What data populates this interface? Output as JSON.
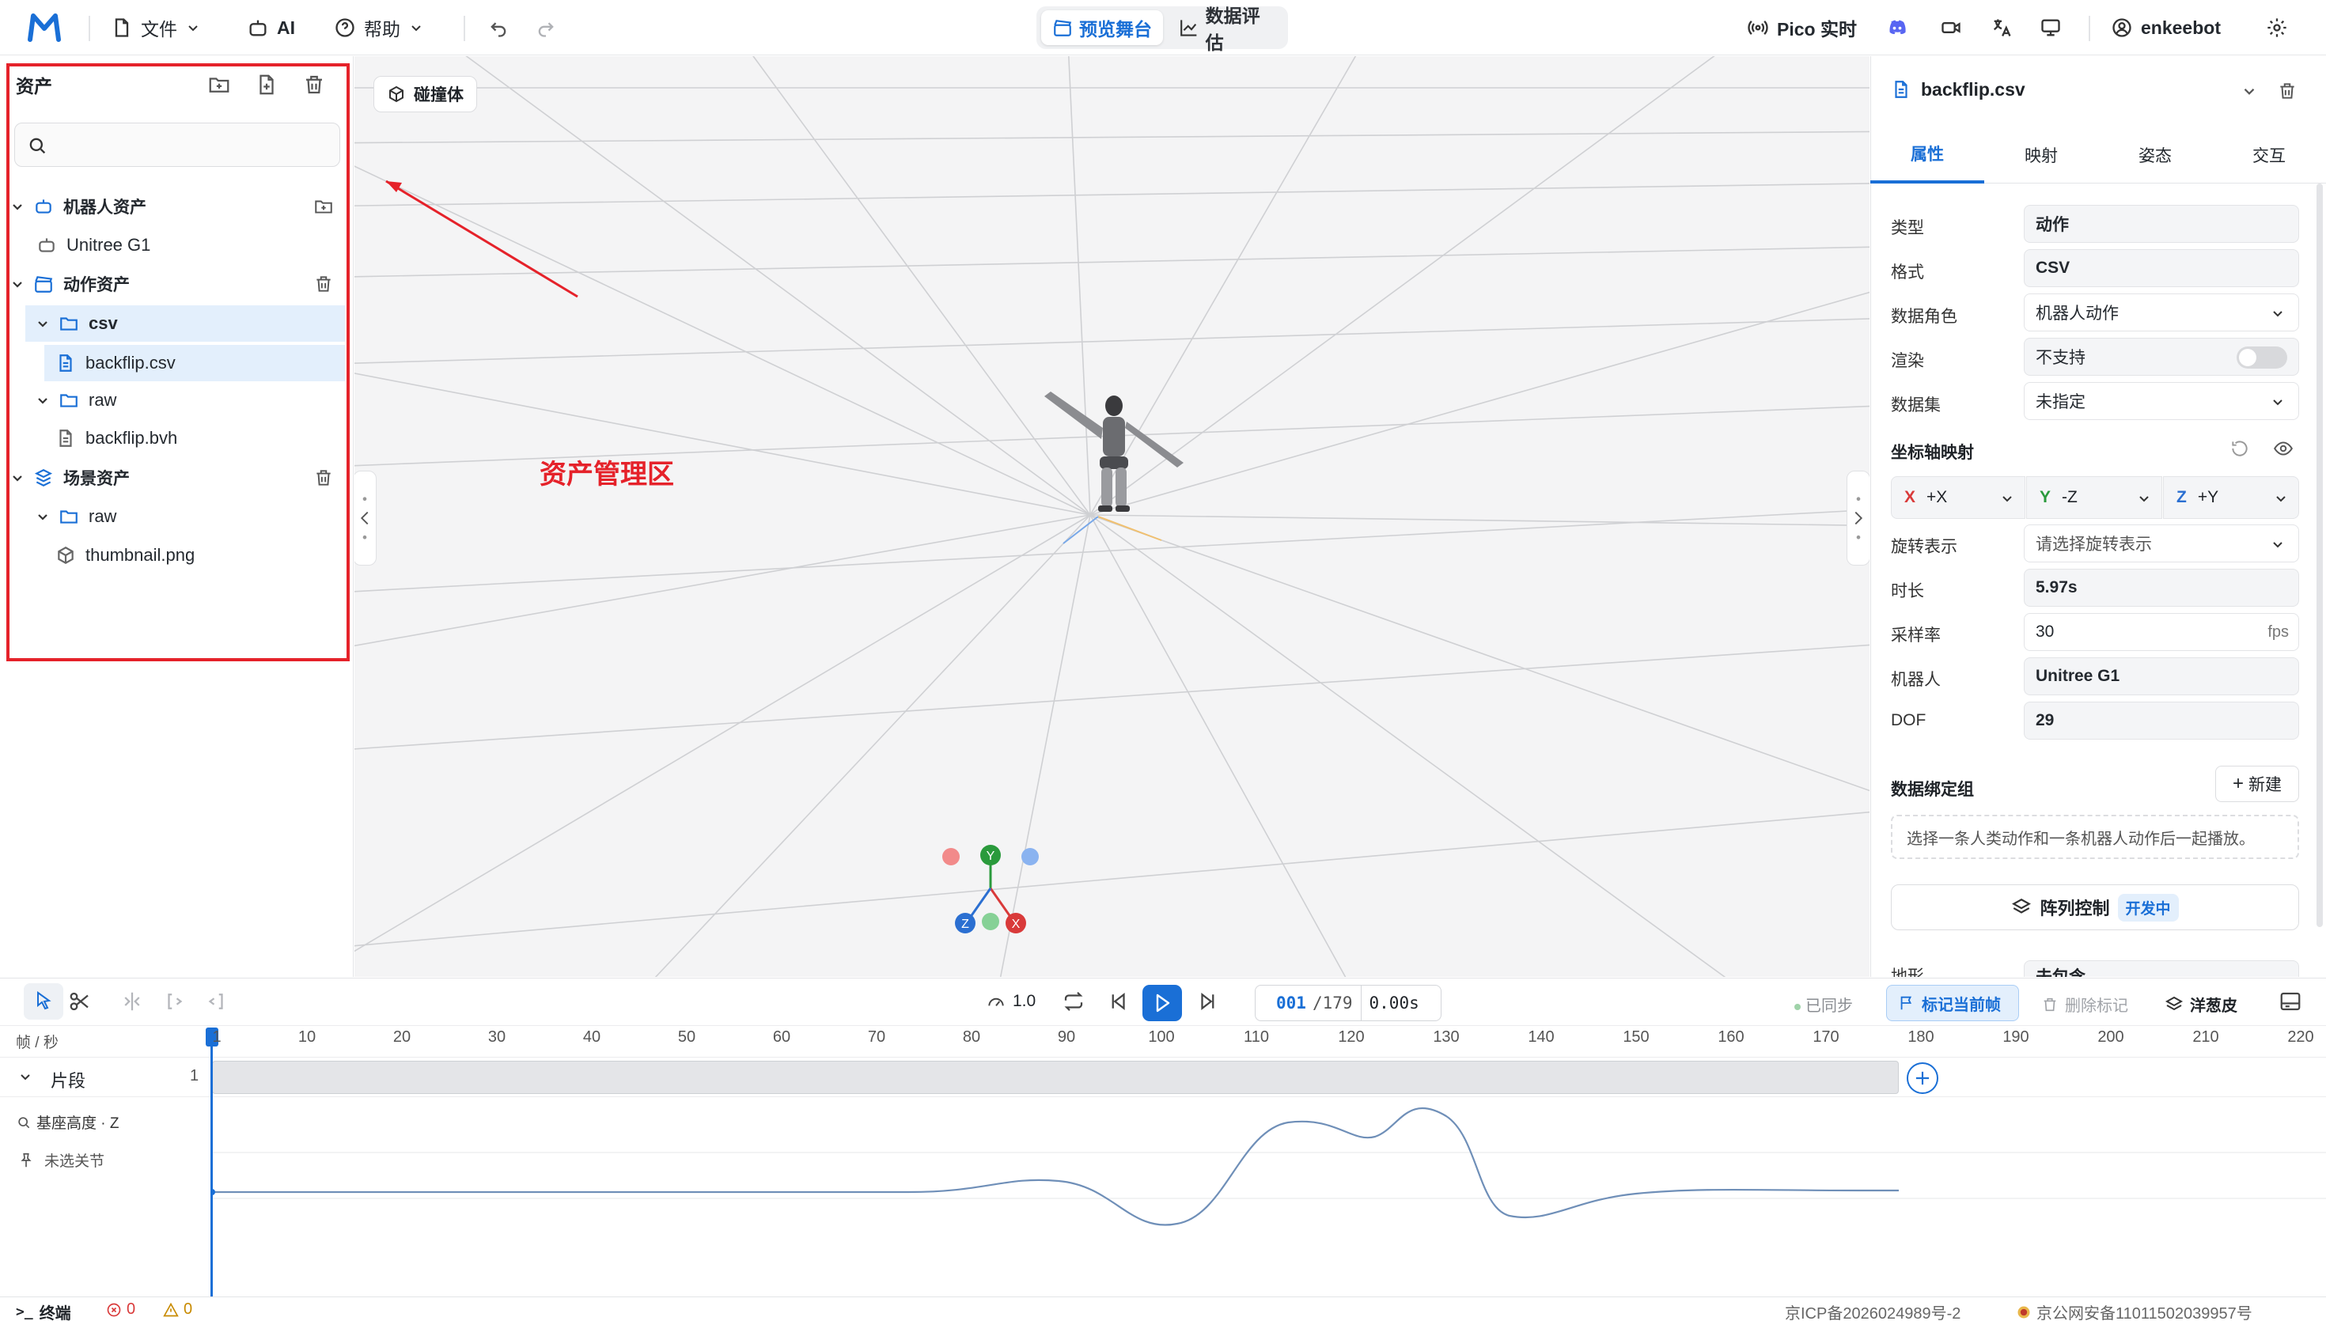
{
  "topbar": {
    "file_label": "文件",
    "ai_label": "AI",
    "help_label": "帮助",
    "mode_preview": "预览舞台",
    "mode_eval": "数据评估",
    "pico_label": "Pico 实时",
    "user_name": "enkeebot"
  },
  "left_panel": {
    "title": "资产",
    "search_placeholder": "",
    "tree": [
      {
        "label": "机器人资产",
        "kind": "group",
        "icon": "robot-icon"
      },
      {
        "label": "Unitree G1",
        "kind": "item",
        "icon": "robot-icon"
      },
      {
        "label": "动作资产",
        "kind": "group",
        "icon": "clapper-icon"
      },
      {
        "label": "csv",
        "kind": "folder",
        "icon": "folder-icon"
      },
      {
        "label": "backflip.csv",
        "kind": "file",
        "icon": "file-icon"
      },
      {
        "label": "raw",
        "kind": "folder",
        "icon": "folder-icon"
      },
      {
        "label": "backflip.bvh",
        "kind": "file",
        "icon": "file-icon"
      },
      {
        "label": "场景资产",
        "kind": "group",
        "icon": "cube-stack-icon"
      },
      {
        "label": "raw",
        "kind": "folder",
        "icon": "folder-icon"
      },
      {
        "label": "thumbnail.png",
        "kind": "file",
        "icon": "cube-icon"
      }
    ]
  },
  "viewport": {
    "collider_label": "碰撞体",
    "annotation_label": "资产管理区",
    "gizmo": {
      "x": "X",
      "y": "Y",
      "z": "Z"
    }
  },
  "right_panel": {
    "file_name": "backflip.csv",
    "tabs": [
      "属性",
      "映射",
      "姿态",
      "交互"
    ],
    "props": {
      "type": {
        "label": "类型",
        "value": "动作"
      },
      "format": {
        "label": "格式",
        "value": "CSV"
      },
      "role": {
        "label": "数据角色",
        "value": "机器人动作"
      },
      "render": {
        "label": "渲染",
        "value": "不支持"
      },
      "dataset": {
        "label": "数据集",
        "value": "未指定"
      }
    },
    "axis_section": "坐标轴映射",
    "axes": [
      {
        "axis": "X",
        "value": "+X",
        "color": "#d93a3a"
      },
      {
        "axis": "Y",
        "value": "-Z",
        "color": "#2a9a3c"
      },
      {
        "axis": "Z",
        "value": "+Y",
        "color": "#2b6fd1"
      }
    ],
    "props2": {
      "rotation": {
        "label": "旋转表示",
        "value": "请选择旋转表示"
      },
      "duration": {
        "label": "时长",
        "value": "5.97s"
      },
      "rate": {
        "label": "采样率",
        "value": "30",
        "unit": "fps"
      },
      "robot": {
        "label": "机器人",
        "value": "Unitree G1"
      },
      "dof": {
        "label": "DOF",
        "value": "29"
      }
    },
    "binding_section": "数据绑定组",
    "new_label": "新建",
    "binding_hint": "选择一条人类动作和一条机器人动作后一起播放。",
    "array_label": "阵列控制",
    "array_badge": "开发中",
    "clipped_label": "地形",
    "clipped_value": "未包含"
  },
  "timeline": {
    "speed": "1.0",
    "frame_current": "001",
    "frame_total": "/179",
    "frame_time": "0.00s",
    "sync_label": "已同步",
    "mark_label": "标记当前帧",
    "delete_mark_label": "删除标记",
    "onion_label": "洋葱皮",
    "ruler_label": "帧 / 秒",
    "ticks": [
      "1",
      "10",
      "20",
      "30",
      "40",
      "50",
      "60",
      "70",
      "80",
      "90",
      "100",
      "110",
      "120",
      "130",
      "140",
      "150",
      "160",
      "170",
      "180",
      "190",
      "200",
      "210",
      "220"
    ],
    "track_label": "片段",
    "track_count": "1",
    "curve_label": "基座高度 · Z",
    "joint_label": "未选关节"
  },
  "statusbar": {
    "terminal_label": "终端",
    "errors": "0",
    "warnings": "0",
    "icp": "京ICP备2026024989号-2",
    "police": "京公网安备11011502039957号"
  }
}
